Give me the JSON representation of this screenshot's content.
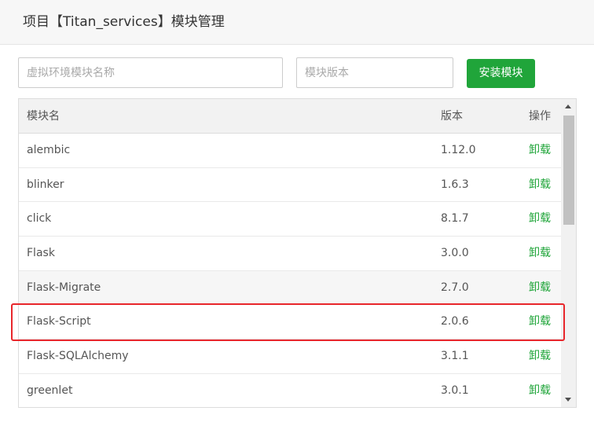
{
  "dialog": {
    "title": "项目【Titan_services】模块管理"
  },
  "form": {
    "env_placeholder": "虚拟环境模块名称",
    "ver_placeholder": "模块版本",
    "install_label": "安装模块"
  },
  "table": {
    "headers": {
      "name": "模块名",
      "version": "版本",
      "action": "操作"
    },
    "rows": [
      {
        "name": "alembic",
        "version": "1.12.0",
        "action": "卸载"
      },
      {
        "name": "blinker",
        "version": "1.6.3",
        "action": "卸载"
      },
      {
        "name": "click",
        "version": "8.1.7",
        "action": "卸载"
      },
      {
        "name": "Flask",
        "version": "3.0.0",
        "action": "卸载"
      },
      {
        "name": "Flask-Migrate",
        "version": "2.7.0",
        "action": "卸载"
      },
      {
        "name": "Flask-Script",
        "version": "2.0.6",
        "action": "卸载"
      },
      {
        "name": "Flask-SQLAlchemy",
        "version": "3.1.1",
        "action": "卸载"
      },
      {
        "name": "greenlet",
        "version": "3.0.1",
        "action": "卸载"
      }
    ]
  },
  "colors": {
    "accent": "#20a53a",
    "highlight": "#e8262b"
  }
}
